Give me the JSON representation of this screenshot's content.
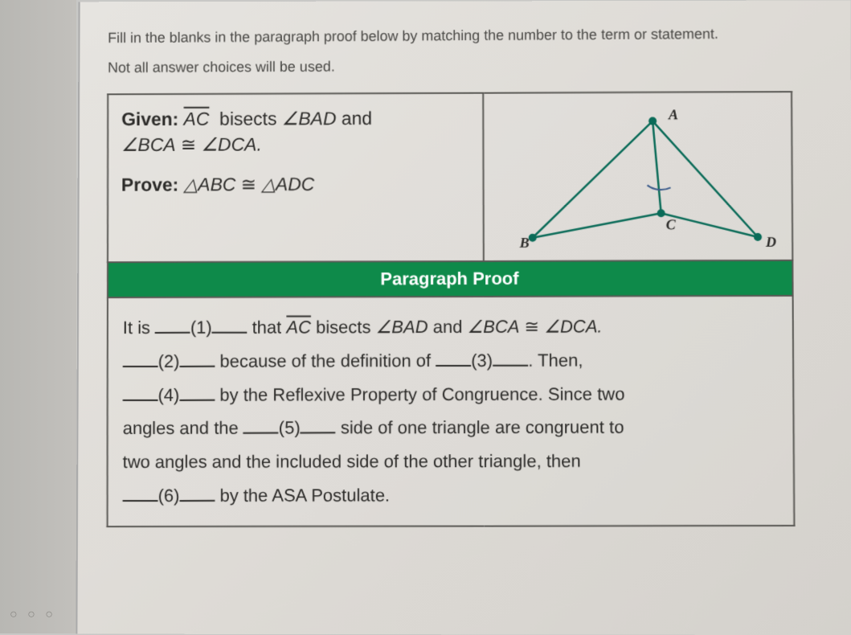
{
  "instructions": {
    "line1": "Fill in the blanks in the paragraph proof below by matching the number to the term or statement.",
    "line2": "Not all answer choices will be used."
  },
  "given": {
    "label": "Given:",
    "seg": "AC",
    "text1a": "bisects",
    "ang1": "∠BAD",
    "text1b": "and",
    "ang2a": "∠BCA",
    "cong": "≅",
    "ang2b": "∠DCA."
  },
  "prove": {
    "label": "Prove:",
    "tri1": "△ABC",
    "cong": "≅",
    "tri2": "△ADC"
  },
  "diagram": {
    "A": "A",
    "B": "B",
    "C": "C",
    "D": "D"
  },
  "proof_header": "Paragraph Proof",
  "proof": {
    "p1a": "It is",
    "num1": "(1)",
    "p1b": "that",
    "seg1": "AC",
    "p1c": "bisects",
    "ang_bad": "∠BAD",
    "p1d": "and",
    "ang_bca": "∠BCA",
    "cong": "≅",
    "ang_dca": "∠DCA.",
    "num2": "(2)",
    "p2a": "because of the definition of",
    "num3": "(3)",
    "p2b": ". Then,",
    "num4": "(4)",
    "p3a": "by the Reflexive Property of Congruence. Since two",
    "p3b": "angles and the",
    "num5": "(5)",
    "p3c": "side of one triangle are congruent to",
    "p3d": "two angles and the included side of the other triangle, then",
    "num6": "(6)",
    "p3e": "by the ASA Postulate."
  },
  "dots": "○ ○ ○"
}
